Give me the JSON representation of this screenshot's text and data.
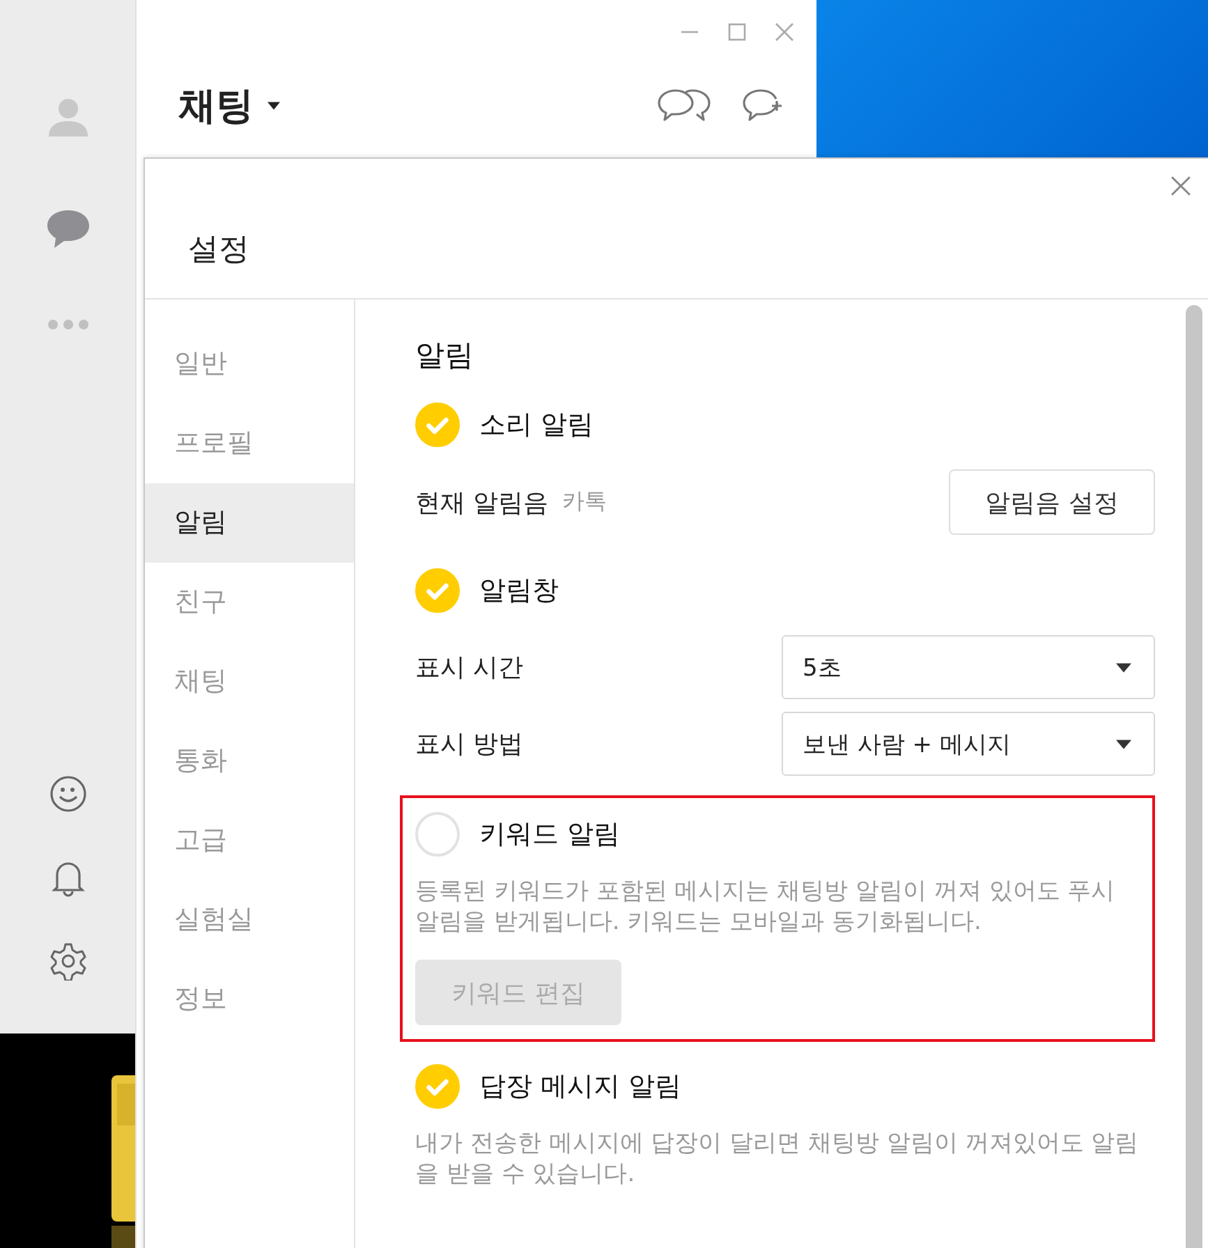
{
  "sidebar": {
    "items": [
      {
        "kind": "person",
        "selected": false
      },
      {
        "kind": "chat",
        "selected": true
      },
      {
        "kind": "more",
        "selected": false
      }
    ],
    "bottom_items": [
      {
        "kind": "emoji"
      },
      {
        "kind": "bell"
      },
      {
        "kind": "gear"
      }
    ]
  },
  "chat_window": {
    "title": "채팅"
  },
  "settings_dialog": {
    "title": "설정",
    "menu": [
      {
        "label": "일반",
        "selected": false
      },
      {
        "label": "프로필",
        "selected": false
      },
      {
        "label": "알림",
        "selected": true
      },
      {
        "label": "친구",
        "selected": false
      },
      {
        "label": "채팅",
        "selected": false
      },
      {
        "label": "통화",
        "selected": false
      },
      {
        "label": "고급",
        "selected": false
      },
      {
        "label": "실험실",
        "selected": false
      },
      {
        "label": "정보",
        "selected": false
      }
    ],
    "section_title": "알림",
    "rows": [
      {
        "kind": "check",
        "label": "소리 알림",
        "checked": true
      },
      {
        "kind": "sound",
        "label": "현재 알림음",
        "value": "카톡",
        "button": "알림음 설정"
      },
      {
        "kind": "check",
        "label": "알림창",
        "checked": true
      },
      {
        "kind": "select",
        "label": "표시 시간",
        "value": "5초"
      },
      {
        "kind": "select",
        "label": "표시 방법",
        "value": "보낸 사람 + 메시지"
      },
      {
        "kind": "check",
        "label": "키워드 알림",
        "checked": false,
        "highlighted": true,
        "description": "등록된 키워드가 포함된 메시지는 채팅방 알림이 꺼져 있어도 푸시 알림을 받게됩니다. 키워드는 모바일과 동기화됩니다.",
        "button": "키워드 편집",
        "button_disabled": true
      },
      {
        "kind": "check",
        "label": "답장 메시지 알림",
        "checked": true,
        "description": "내가 전송한 메시지에 답장이 달리면 채팅방 알림이 꺼져있어도 알림을 받을 수 있습니다."
      }
    ]
  }
}
